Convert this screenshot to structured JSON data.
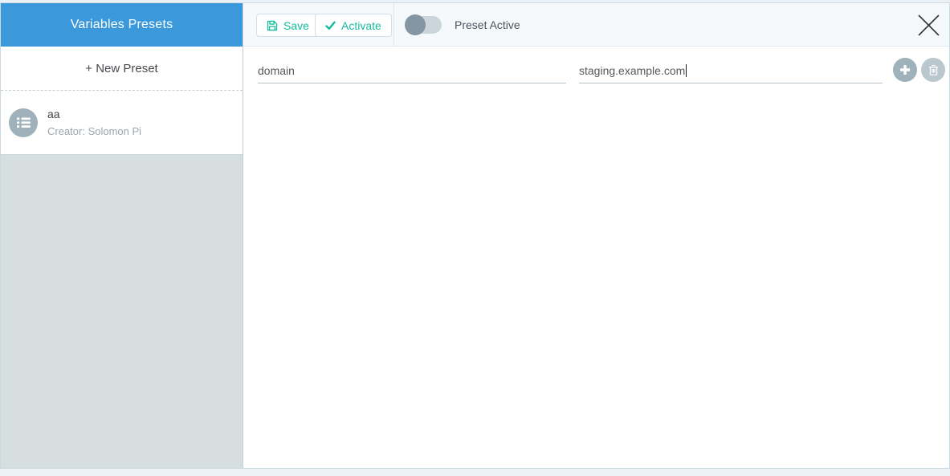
{
  "sidebar": {
    "title": "Variables Presets",
    "new_preset_label": "+ New Preset",
    "presets": [
      {
        "name": "aa",
        "creator": "Creator: Solomon Pi"
      }
    ]
  },
  "toolbar": {
    "save_label": "Save",
    "activate_label": "Activate",
    "preset_active_label": "Preset Active",
    "preset_active_on": false
  },
  "variables": [
    {
      "key": "domain",
      "value": "staging.example.com"
    }
  ],
  "icons": {
    "save": "floppy-disk",
    "activate": "check",
    "preset_avatar": "list",
    "add": "plus",
    "delete": "trash",
    "close": "x"
  },
  "colors": {
    "header_blue": "#3b99db",
    "accent_teal": "#18bc9c",
    "sidebar_gray": "#d7dedf",
    "toolbar_bg": "#f6f9fb",
    "toggle_track": "#cbd5da",
    "toggle_knob": "#8496a1",
    "avatar_gray": "#9fb1ba",
    "muted_text": "#9aa6ad"
  }
}
